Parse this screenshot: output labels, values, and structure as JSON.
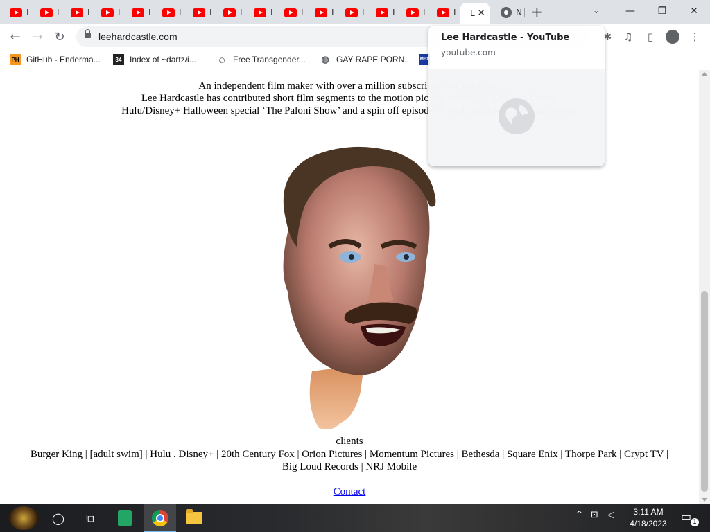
{
  "browser": {
    "tabs": [
      {
        "label": "I",
        "icon": "youtube-icon"
      },
      {
        "label": "L",
        "icon": "youtube-icon"
      },
      {
        "label": "L",
        "icon": "youtube-icon"
      },
      {
        "label": "L",
        "icon": "youtube-icon"
      },
      {
        "label": "L",
        "icon": "youtube-icon"
      },
      {
        "label": "L",
        "icon": "youtube-icon"
      },
      {
        "label": "L",
        "icon": "youtube-icon"
      },
      {
        "label": "L",
        "icon": "youtube-icon"
      },
      {
        "label": "L",
        "icon": "youtube-icon"
      },
      {
        "label": "L",
        "icon": "youtube-icon"
      },
      {
        "label": "L",
        "icon": "youtube-icon"
      },
      {
        "label": "L",
        "icon": "youtube-icon"
      },
      {
        "label": "L",
        "icon": "youtube-icon"
      },
      {
        "label": "L",
        "icon": "youtube-icon"
      },
      {
        "label": "L",
        "icon": "youtube-icon"
      }
    ],
    "active_tab": {
      "label": "L",
      "close": "✕"
    },
    "last_tab": {
      "label": "N",
      "icon": "chrome-icon"
    },
    "new_tab": "+",
    "tab_search": "⌄",
    "window_controls": {
      "minimize": "—",
      "maximize": "❐",
      "close": "✕"
    },
    "url": "leehardcastle.com",
    "bookmarks": [
      {
        "label": "GitHub - Enderma...",
        "icon": "ph-icon",
        "icon_text": "PH"
      },
      {
        "label": "Index of ~dartz/i...",
        "icon": "index-icon",
        "icon_text": "34"
      },
      {
        "label": "Free Transgender...",
        "icon": "mask-icon",
        "icon_text": ""
      },
      {
        "label": "GAY RAPE PORN...",
        "icon": "globe-icon",
        "icon_text": ""
      }
    ],
    "hover_card": {
      "title": "Lee Hardcastle - YouTube",
      "domain": "youtube.com"
    }
  },
  "page": {
    "intro_lines": [
      "An independent film maker with over a million subscribers on YouTube.",
      "Lee Hardcastle has contributed short film segments to the motion picture anthology ABCs of Death,",
      "Hulu/Disney+ Halloween special ‘The Paloni Show’ and a spin off episode of Rick and Morty on adult swim."
    ],
    "clients_title": "clients",
    "clients_line1": "Burger King | [adult swim] | Hulu . Disney+ | 20th Century Fox | Orion Pictures | Momentum Pictures | Bethesda | Square Enix | Thorpe Park | Crypt TV |",
    "clients_line2": "Big Loud Records | NRJ Mobile",
    "contact": "Contact"
  },
  "taskbar": {
    "time": "3:11 AM",
    "date": "4/18/2023",
    "notifications": "1",
    "tray_chevron": "^"
  },
  "colors": {
    "youtube_red": "#ff0000",
    "link_blue": "#0000ee",
    "taskbar": "#1e2024"
  }
}
